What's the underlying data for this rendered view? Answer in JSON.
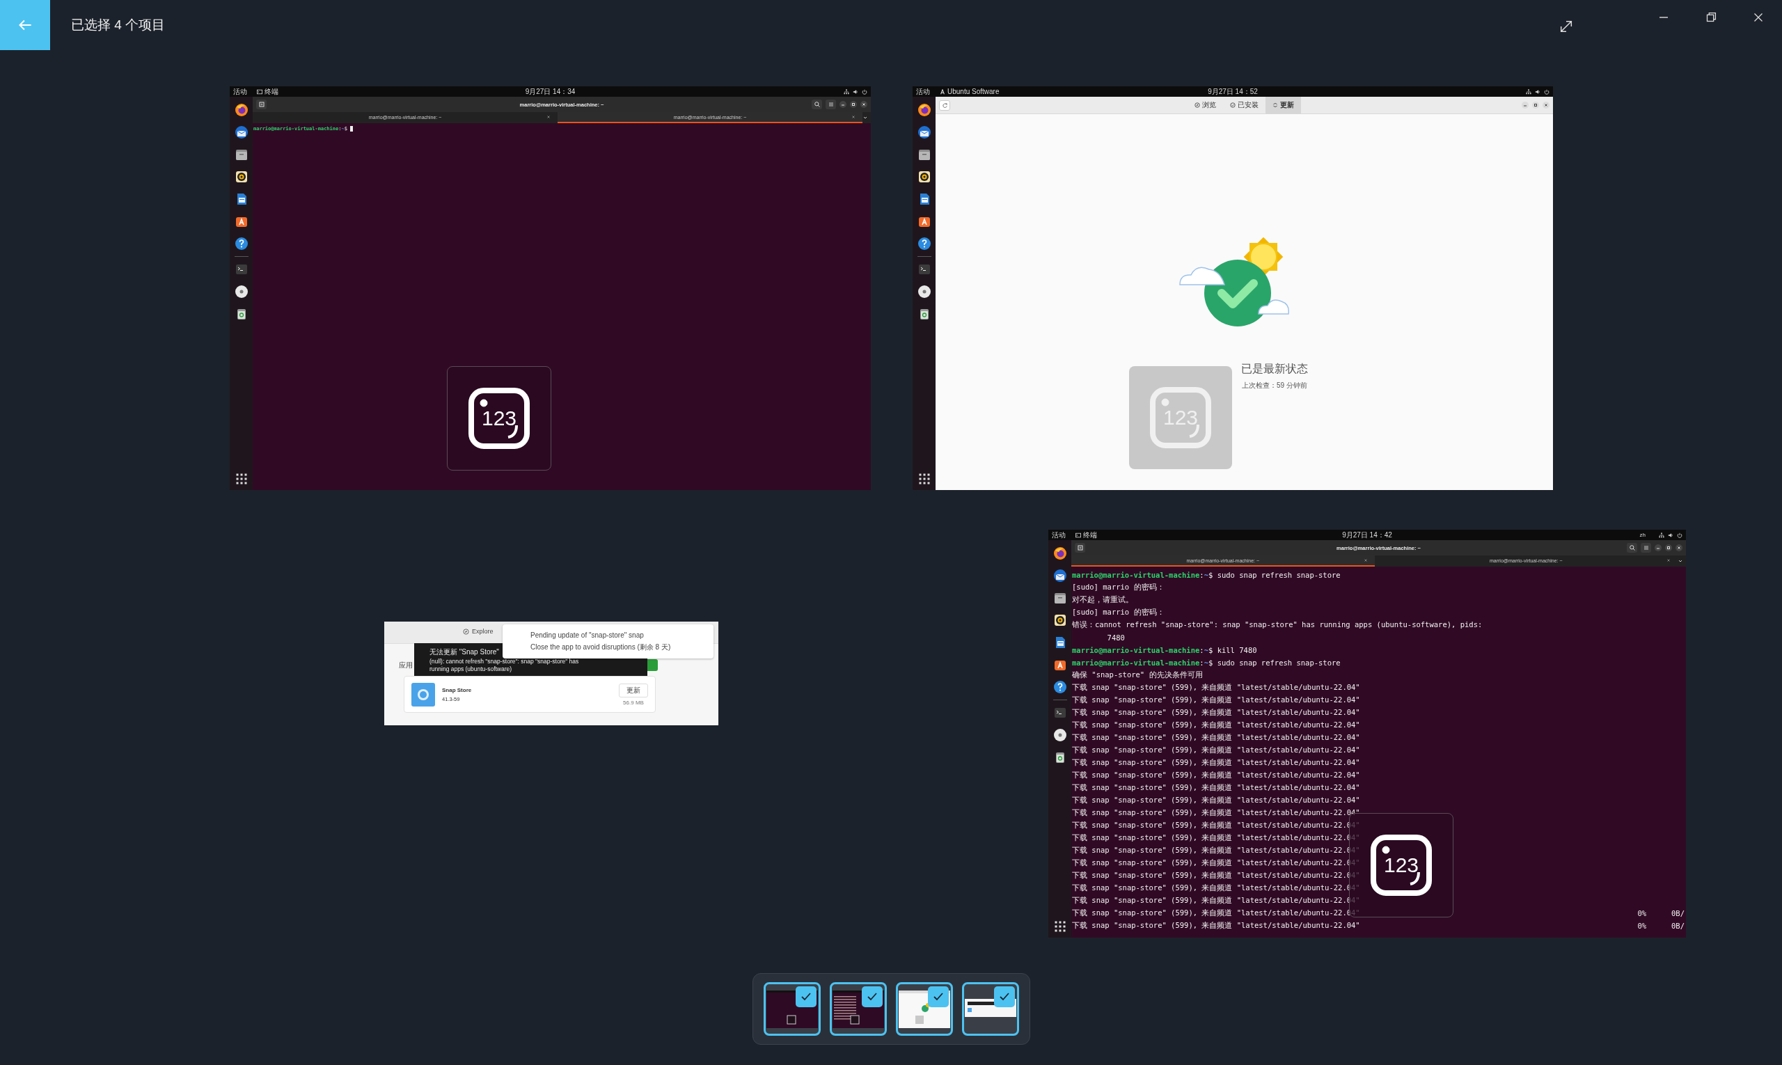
{
  "header": {
    "title": "已选择 4 个项目"
  },
  "images": [
    {
      "kind": "terminal",
      "topbar": {
        "activities": "活动",
        "app": "终端",
        "clock": "9月27日 14：34"
      },
      "window_title": "marrio@marrio-virtual-machine: ~",
      "tabs": [
        {
          "label": "marrio@marrio-virtual-machine: ~",
          "selected": false
        },
        {
          "label": "marrio@marrio-virtual-machine: ~",
          "selected": true
        }
      ],
      "lines": [
        {
          "kind": "prompt",
          "host": "marrio@marrio-virtual-machine",
          "sep": ":",
          "path": "~",
          "text": "$",
          "cursor": true
        }
      ],
      "osd": {
        "kind": "dark",
        "label": "123"
      }
    },
    {
      "kind": "software",
      "topbar": {
        "activities": "活动",
        "app": "Ubuntu Software",
        "clock": "9月27日 14：52"
      },
      "tabs": [
        {
          "kind": "explore",
          "label": "浏览",
          "selected": false
        },
        {
          "kind": "installed",
          "label": "已安装",
          "selected": false
        },
        {
          "kind": "updates",
          "label": "更新",
          "selected": true
        }
      ],
      "status": {
        "title": "已是最新状态",
        "subtitle": "上次检查：59 分钟前"
      },
      "osd": {
        "kind": "light",
        "label": "123"
      }
    },
    {
      "kind": "snap_store",
      "tab": "Explore",
      "section_label": "应用",
      "notification": {
        "title": "Pending update of \"snap-store\" snap",
        "body": "Close the app to avoid disruptions (剩余 8 天)"
      },
      "toast_lines": [
        "无法更新 \"Snap Store\"",
        "(null): cannot refresh \"snap-store\": snap \"snap-store\" has",
        "running apps (ubuntu-software)"
      ],
      "app": {
        "name": "Snap Store",
        "version": "41.3-59",
        "button": "更新",
        "size": "56.9 MB"
      }
    },
    {
      "kind": "terminal",
      "topbar": {
        "activities": "活动",
        "app": "终端",
        "clock": "9月27日 14：42",
        "input_method": "zh"
      },
      "window_title": "marrio@marrio-virtual-machine: ~",
      "tabs": [
        {
          "label": "marrio@marrio-virtual-machine: ~",
          "selected": true
        },
        {
          "label": "marrio@marrio-virtual-machine: ~",
          "selected": false
        }
      ],
      "lines": [
        {
          "kind": "prompt",
          "host": "marrio@marrio-virtual-machine",
          "sep": ":",
          "path": "~",
          "text": "$ sudo snap refresh snap-store"
        },
        {
          "kind": "output",
          "text": "[sudo] marrio 的密码："
        },
        {
          "kind": "output",
          "text": "对不起，请重试。"
        },
        {
          "kind": "output",
          "text": "[sudo] marrio 的密码："
        },
        {
          "kind": "output",
          "text": "错误：cannot refresh \"snap-store\": snap \"snap-store\" has running apps (ubuntu-software), pids:"
        },
        {
          "kind": "output",
          "text": "        7480"
        },
        {
          "kind": "prompt",
          "host": "marrio@marrio-virtual-machine",
          "sep": ":",
          "path": "~",
          "text": "$ kill 7480"
        },
        {
          "kind": "prompt",
          "host": "marrio@marrio-virtual-machine",
          "sep": ":",
          "path": "~",
          "text": "$ sudo snap refresh snap-store"
        },
        {
          "kind": "output",
          "text": "确保 \"snap-store\" 的先决条件可用"
        },
        {
          "kind": "output",
          "text": "下载 snap \"snap-store\" (599), 来自频道 \"latest/stable/ubuntu-22.04\""
        },
        {
          "kind": "output",
          "text": "下载 snap \"snap-store\" (599), 来自频道 \"latest/stable/ubuntu-22.04\""
        },
        {
          "kind": "output",
          "text": "下载 snap \"snap-store\" (599), 来自频道 \"latest/stable/ubuntu-22.04\""
        },
        {
          "kind": "output",
          "text": "下载 snap \"snap-store\" (599), 来自频道 \"latest/stable/ubuntu-22.04\""
        },
        {
          "kind": "output",
          "text": "下载 snap \"snap-store\" (599), 来自频道 \"latest/stable/ubuntu-22.04\""
        },
        {
          "kind": "output",
          "text": "下载 snap \"snap-store\" (599), 来自频道 \"latest/stable/ubuntu-22.04\""
        },
        {
          "kind": "output",
          "text": "下载 snap \"snap-store\" (599), 来自频道 \"latest/stable/ubuntu-22.04\""
        },
        {
          "kind": "output",
          "text": "下载 snap \"snap-store\" (599), 来自频道 \"latest/stable/ubuntu-22.04\""
        },
        {
          "kind": "output",
          "text": "下载 snap \"snap-store\" (599), 来自频道 \"latest/stable/ubuntu-22.04\""
        },
        {
          "kind": "output",
          "text": "下载 snap \"snap-store\" (599), 来自频道 \"latest/stable/ubuntu-22.04\""
        },
        {
          "kind": "output",
          "text": "下载 snap \"snap-store\" (599), 来自频道 \"latest/stable/ubuntu-22.04\""
        },
        {
          "kind": "output",
          "text": "下载 snap \"snap-store\" (599), 来自频道 \"latest/stable/ubuntu-22.04\""
        },
        {
          "kind": "output",
          "text": "下载 snap \"snap-store\" (599), 来自频道 \"latest/stable/ubuntu-22.04\""
        },
        {
          "kind": "output",
          "text": "下载 snap \"snap-store\" (599), 来自频道 \"latest/stable/ubuntu-22.04\""
        },
        {
          "kind": "output",
          "text": "下载 snap \"snap-store\" (599), 来自频道 \"latest/stable/ubuntu-22.04\""
        },
        {
          "kind": "output",
          "text": "下载 snap \"snap-store\" (599), 来自频道 \"latest/stable/ubuntu-22.04\""
        },
        {
          "kind": "output",
          "text": "下载 snap \"snap-store\" (599), 来自频道 \"latest/stable/ubuntu-22.04\""
        },
        {
          "kind": "output",
          "text": "下载 snap \"snap-store\" (599), 来自频道 \"latest/stable/ubuntu-22.04\""
        },
        {
          "kind": "output",
          "text": "下载 snap \"snap-store\" (599), 来自频道 \"latest/stable/ubuntu-22.04\"",
          "percent": "0%",
          "rate": "0B/"
        },
        {
          "kind": "output",
          "text": "下载 snap \"snap-store\" (599), 来自频道 \"latest/stable/ubuntu-22.04\"",
          "percent": "0%",
          "rate": "0B/"
        }
      ],
      "osd": {
        "kind": "dark",
        "label": "123"
      }
    }
  ],
  "thumbnails": [
    {
      "kind": "terminal",
      "checked": true
    },
    {
      "kind": "terminal_log",
      "checked": true
    },
    {
      "kind": "software",
      "checked": true
    },
    {
      "kind": "snap_store",
      "checked": true
    }
  ]
}
